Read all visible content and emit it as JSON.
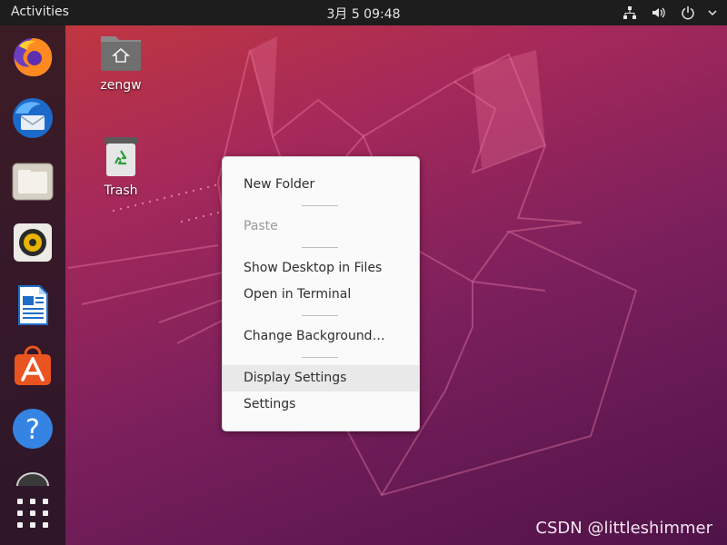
{
  "topbar": {
    "activities_label": "Activities",
    "clock": "3月 5  09:48",
    "tray_icons": [
      "network-icon",
      "volume-icon",
      "power-icon",
      "chevron-down-icon"
    ]
  },
  "dock": {
    "items": [
      {
        "name": "firefox",
        "icon": "firefox-icon"
      },
      {
        "name": "thunderbird",
        "icon": "thunderbird-icon"
      },
      {
        "name": "files",
        "icon": "files-icon"
      },
      {
        "name": "rhythmbox",
        "icon": "rhythmbox-icon"
      },
      {
        "name": "libreoffice-writer",
        "icon": "writer-icon"
      },
      {
        "name": "ubuntu-software",
        "icon": "software-icon"
      },
      {
        "name": "help",
        "icon": "help-icon"
      },
      {
        "name": "partially-visible-app",
        "icon": "app-icon"
      },
      {
        "name": "show-applications",
        "icon": "grid-icon"
      }
    ]
  },
  "desktop": {
    "icons": [
      {
        "label": "zengw",
        "icon": "home-folder-icon"
      },
      {
        "label": "Trash",
        "icon": "trash-icon"
      }
    ]
  },
  "context_menu": {
    "items": [
      {
        "label": "New Folder",
        "enabled": true
      },
      {
        "label": "Paste",
        "enabled": false
      },
      {
        "label": "Show Desktop in Files",
        "enabled": true
      },
      {
        "label": "Open in Terminal",
        "enabled": true
      },
      {
        "label": "Change Background…",
        "enabled": true
      },
      {
        "label": "Display Settings",
        "enabled": true,
        "highlighted": true
      },
      {
        "label": "Settings",
        "enabled": true
      }
    ]
  },
  "watermark": "CSDN @littleshimmer",
  "colors": {
    "topbar": "#1d1d1d",
    "menu_bg": "#fafafa",
    "menu_highlight": "#e9e9e9",
    "wallpaper_top": "#c73a3a",
    "wallpaper_bottom": "#4f1348"
  }
}
